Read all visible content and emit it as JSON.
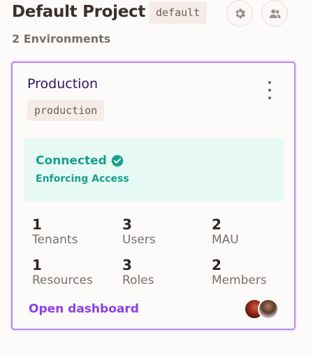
{
  "project": {
    "title": "Default Project",
    "slug": "default",
    "settings_icon": "gear-icon",
    "members_icon": "people-icon",
    "env_count_text": "2 Environments"
  },
  "environment": {
    "name": "Production",
    "slug": "production",
    "menu_icon": "kebab-menu-icon",
    "status": {
      "title": "Connected",
      "subtitle": "Enforcing Access",
      "icon": "check-circle-icon",
      "color": "#1a9f8a"
    },
    "stats": [
      {
        "value": "1",
        "label": "Tenants"
      },
      {
        "value": "3",
        "label": "Users"
      },
      {
        "value": "2",
        "label": "MAU"
      },
      {
        "value": "1",
        "label": "Resources"
      },
      {
        "value": "3",
        "label": "Roles"
      },
      {
        "value": "2",
        "label": "Members"
      }
    ],
    "open_link": "Open dashboard",
    "accent": "#8e3fe6"
  }
}
